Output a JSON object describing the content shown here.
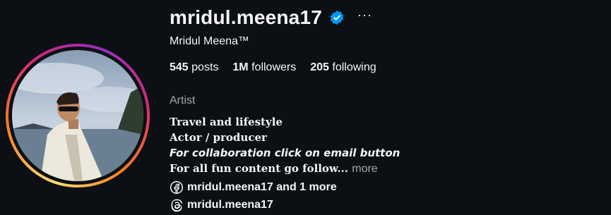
{
  "profile": {
    "username": "mridul.meena17",
    "full_name": "Mridul Meena™",
    "verified": true,
    "more_options_label": "···",
    "category": "Artist"
  },
  "stats": {
    "posts_count": "545",
    "posts_label": "posts",
    "followers_count": "1M",
    "followers_label": "followers",
    "following_count": "205",
    "following_label": "following"
  },
  "bio": {
    "line1": "Travel and lifestyle",
    "line2": "Actor / producer",
    "line3": "For collaboration click on email button",
    "line4": "For all fun content go follow...",
    "more_label": "more"
  },
  "links": {
    "facebook_text": "mridul.meena17 and 1 more",
    "threads_text": "mridul.meena17"
  },
  "colors": {
    "background": "#0c1014",
    "verified_badge": "#0095f6",
    "secondary_text": "#a8a8a8"
  }
}
